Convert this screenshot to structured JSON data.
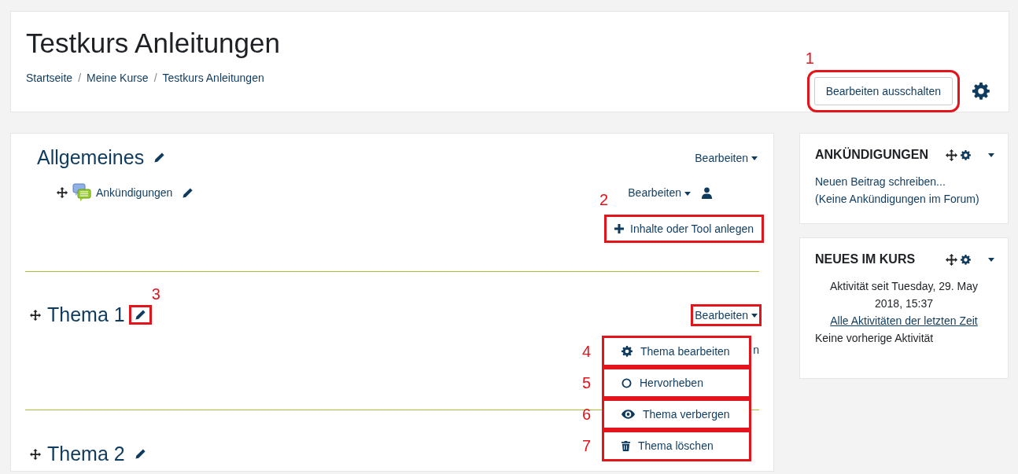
{
  "header": {
    "title": "Testkurs Anleitungen",
    "breadcrumb": [
      "Startseite",
      "Meine Kurse",
      "Testkurs Anleitungen"
    ],
    "breadcrumb_separator": "/",
    "edit_button": {
      "label": "Bearbeiten ausschalten",
      "annotation": "1"
    }
  },
  "sections": [
    {
      "title": "Allgemeines",
      "movable": false,
      "edit_menu": {
        "label": "Bearbeiten"
      },
      "activities": [
        {
          "name": "Ankündigungen",
          "edit_menu": "Bearbeiten"
        }
      ],
      "add_link": {
        "label": "Inhalte oder Tool anlegen",
        "annotation": "2"
      }
    },
    {
      "title": "Thema 1",
      "movable": true,
      "pencil_annotation": "3",
      "edit_menu": {
        "label": "Bearbeiten",
        "expanded": true,
        "items": [
          {
            "kind": "gear",
            "label": "Thema bearbeiten",
            "annotation": "4"
          },
          {
            "kind": "circle",
            "label": "Hervorheben",
            "annotation": "5"
          },
          {
            "kind": "eye",
            "label": "Thema verbergen",
            "annotation": "6"
          },
          {
            "kind": "trash",
            "label": "Thema löschen",
            "annotation": "7"
          }
        ]
      },
      "add_link": {
        "label": "n"
      }
    },
    {
      "title": "Thema 2",
      "movable": true
    }
  ],
  "blocks": [
    {
      "title": "ANKÜNDIGUNGEN",
      "lines": [
        {
          "kind": "text",
          "text": "Neuen Beitrag schreiben..."
        },
        {
          "kind": "text",
          "text": "(Keine Ankündigungen im Forum)"
        }
      ]
    },
    {
      "title": "NEUES IM KURS",
      "lines": [
        {
          "kind": "center",
          "text": "Aktivität seit Tuesday, 29. May 2018, 15:37"
        },
        {
          "kind": "link",
          "text": "Alle Aktivitäten der letzten Zeit"
        },
        {
          "kind": "plain",
          "text": "Keine vorherige Aktivität"
        }
      ]
    }
  ]
}
